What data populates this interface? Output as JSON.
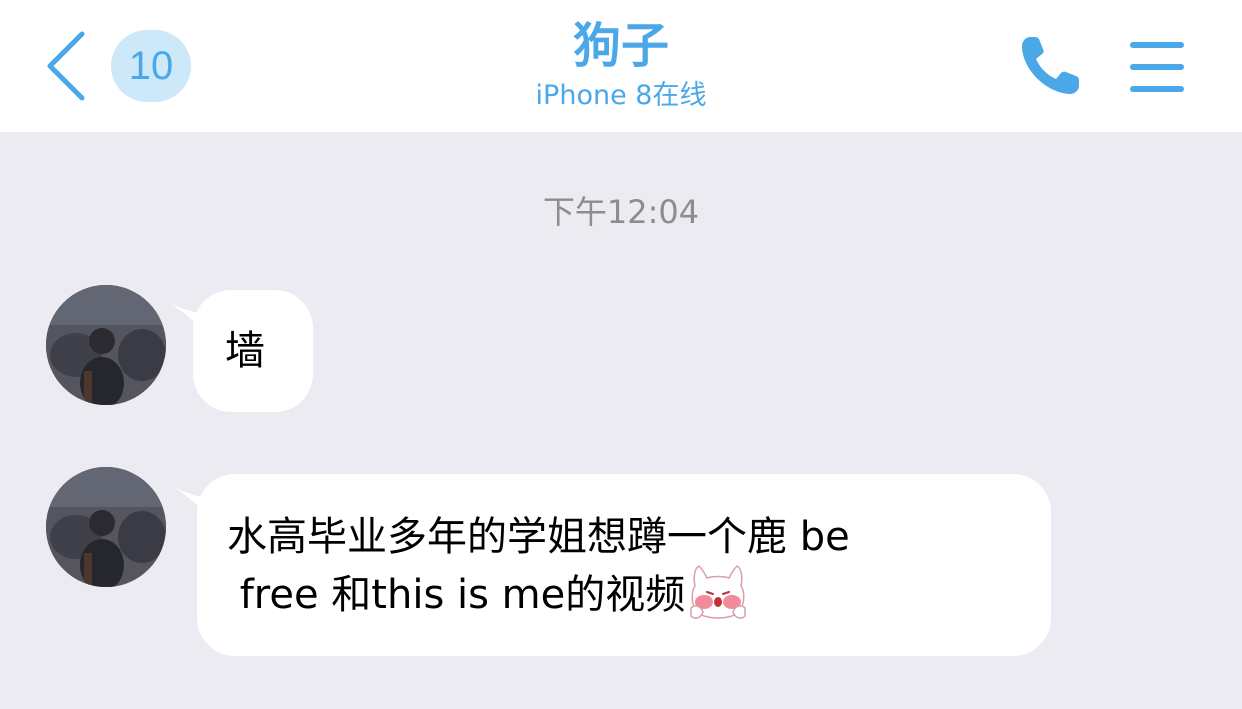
{
  "header": {
    "back_icon": "chevron-left-icon",
    "unread_count": "10",
    "contact_name": "狗子",
    "contact_status": "iPhone 8在线",
    "call_icon": "phone-icon",
    "menu_icon": "menu-icon",
    "accent_color": "#4aa8e8"
  },
  "chat": {
    "timestamp": "下午12:04",
    "messages": [
      {
        "sender": "contact",
        "text": "墙"
      },
      {
        "sender": "contact",
        "text": "水高毕业多年的学姐想蹲一个鹿 be\n free 和this is me的视频",
        "emoji": "blushing-cat-face-icon"
      }
    ]
  },
  "colors": {
    "chat_background": "#ebebf1",
    "bubble_background": "#ffffff",
    "timestamp_color": "#8c8c91"
  }
}
